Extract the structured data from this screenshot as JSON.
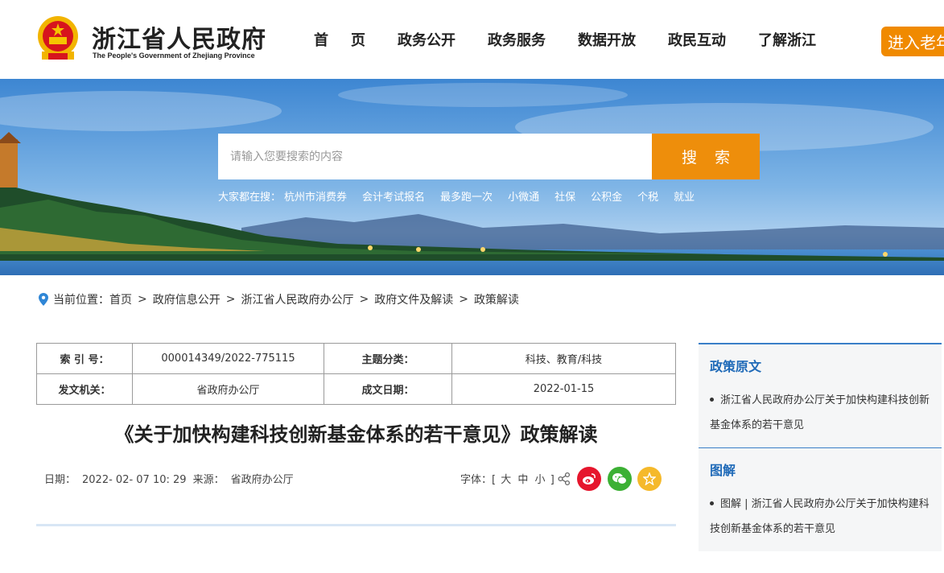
{
  "header": {
    "title": "浙江省人民政府",
    "subtitle": "The People's Government of Zhejiang Province",
    "nav": [
      "首页",
      "政务公开",
      "政务服务",
      "数据开放",
      "政民互动",
      "了解浙江"
    ],
    "elder_button": "进入老年模式"
  },
  "search": {
    "placeholder": "请输入您要搜索的内容",
    "button": "搜 索",
    "hot_label": "大家都在搜：",
    "hot_items": [
      "杭州市消费券",
      "会计考试报名",
      "最多跑一次",
      "小微通",
      "社保",
      "公积金",
      "个税",
      "就业"
    ]
  },
  "breadcrumb": {
    "label": "当前位置：",
    "items": [
      "首页",
      "政府信息公开",
      "浙江省人民政府办公厅",
      "政府文件及解读",
      "政策解读"
    ]
  },
  "meta": {
    "index_label": "索 引 号：",
    "index_value": "000014349/2022-775115",
    "topic_label": "主题分类：",
    "topic_value": "科技、教育/科技",
    "issuer_label": "发文机关：",
    "issuer_value": "省政府办公厅",
    "date_label": "成文日期：",
    "date_value": "2022-01-15"
  },
  "article": {
    "title": "《关于加快构建科技创新基金体系的若干意见》政策解读",
    "date_label": "日期：",
    "date_value": "2022- 02- 07 10: 29",
    "source_label": "来源：",
    "source_value": "省政府办公厅",
    "font_label": "字体：[",
    "font_large": "大",
    "font_medium": "中",
    "font_small": "小",
    "font_close": "]"
  },
  "sidebar": {
    "section1_heading": "政策原文",
    "section1_link": "浙江省人民政府办公厅关于加快构建科技创新基金体系的若干意见",
    "section2_heading": "图解",
    "section2_link": "图解 | 浙江省人民政府办公厅关于加快构建科技创新基金体系的若干意见"
  },
  "colors": {
    "accent_orange": "#ee8e0b",
    "link_blue": "#1f6ab8"
  }
}
